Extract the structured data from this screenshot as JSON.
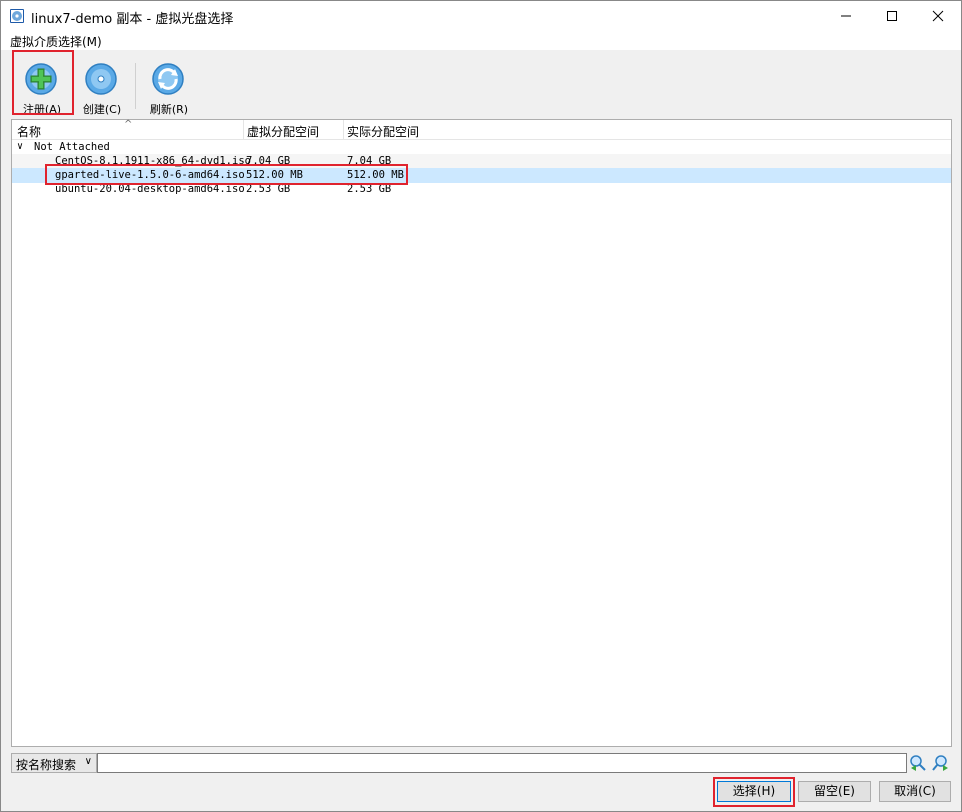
{
  "window": {
    "title": "linux7-demo 副本 - 虚拟光盘选择",
    "icon": "virtualbox-disc-icon"
  },
  "menu": {
    "items": [
      "虚拟介质选择(M)"
    ]
  },
  "toolbar": {
    "register_label": "注册(A)",
    "create_label": "创建(C)",
    "refresh_label": "刷新(R)"
  },
  "table": {
    "columns": [
      "名称",
      "虚拟分配空间",
      "实际分配空间"
    ],
    "group_label": "Not Attached",
    "rows": [
      {
        "name": "CentOS-8.1.1911-x86_64-dvd1.iso",
        "virtual": "7.04 GB",
        "actual": "7.04 GB"
      },
      {
        "name": "gparted-live-1.5.0-6-amd64.iso",
        "virtual": "512.00 MB",
        "actual": "512.00 MB"
      },
      {
        "name": "ubuntu-20.04-desktop-amd64.iso",
        "virtual": "2.53 GB",
        "actual": "2.53 GB"
      }
    ],
    "selected_index": 1
  },
  "search": {
    "mode_label": "按名称搜索",
    "value": ""
  },
  "buttons": {
    "select_label": "选择(H)",
    "leave_empty_label": "留空(E)",
    "cancel_label": "取消(C)"
  },
  "colors": {
    "highlight": "#e0232e",
    "selected_row": "#cce8ff",
    "accent": "#0078d7"
  }
}
